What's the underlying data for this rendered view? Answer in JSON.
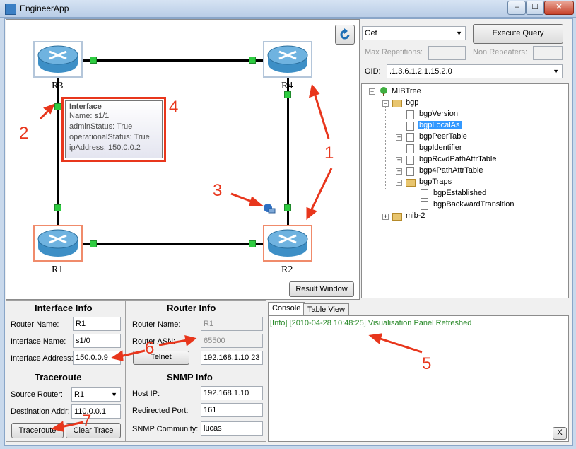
{
  "window": {
    "title": "EngineerApp",
    "minimize": "–",
    "maximize": "☐",
    "close": "✕"
  },
  "canvas": {
    "refresh_icon": "refresh-icon",
    "routers": [
      {
        "label": "R3"
      },
      {
        "label": "R4"
      },
      {
        "label": "R1"
      },
      {
        "label": "R2"
      }
    ],
    "tooltip": {
      "title": "Interface",
      "lines": [
        "Name: s1/1",
        "adminStatus: True",
        "operationalStatus: True",
        "ipAddress: 150.0.0.2"
      ]
    },
    "annotations": [
      "1",
      "2",
      "3",
      "4",
      "5",
      "6",
      "7"
    ],
    "result_window_button": "Result Window"
  },
  "query": {
    "operation": "Get",
    "execute_button": "Execute Query",
    "max_repetitions_label": "Max Repetitions:",
    "non_repeaters_label": "Non Repeaters:",
    "oid_label": "OID:",
    "oid_value": ".1.3.6.1.2.1.15.2.0"
  },
  "tree": {
    "root": "MIBTree",
    "bgp": "bgp",
    "items": [
      "bgpVersion",
      "bgpLocalAs",
      "bgpPeerTable",
      "bgpIdentifier",
      "bgpRcvdPathAttrTable",
      "bgp4PathAttrTable"
    ],
    "traps": "bgpTraps",
    "trap_items": [
      "bgpEstablished",
      "bgpBackwardTransition"
    ],
    "mib2": "mib-2"
  },
  "interface_info": {
    "title": "Interface Info",
    "router_name_label": "Router Name:",
    "router_name": "R1",
    "interface_name_label": "Interface Name:",
    "interface_name": "s1/0",
    "interface_address_label": "Interface Address:",
    "interface_address": "150.0.0.9"
  },
  "router_info": {
    "title": "Router Info",
    "router_name_label": "Router Name:",
    "router_name": "R1",
    "router_asn_label": "Router ASN:",
    "router_asn": "65500",
    "telnet_button": "Telnet",
    "telnet_address": "192.168.1.10 23"
  },
  "traceroute": {
    "title": "Traceroute",
    "source_label": "Source Router:",
    "source": "R1",
    "destination_label": "Destination Addr:",
    "destination": "110.0.0.1",
    "traceroute_button": "Traceroute",
    "clear_button": "Clear Trace"
  },
  "snmp_info": {
    "title": "SNMP Info",
    "host_ip_label": "Host IP:",
    "host_ip": "192.168.1.10",
    "redirected_port_label": "Redirected Port:",
    "redirected_port": "161",
    "community_label": "SNMP Community:",
    "community": "lucas"
  },
  "console": {
    "tabs": [
      "Console",
      "Table View"
    ],
    "message": "[Info] [2010-04-28 10:48:25] Visualisation Panel Refreshed",
    "close_button": "X"
  },
  "colors": {
    "accent_red": "#e8361c",
    "link_green": "#2ecc40",
    "console_text": "#2a8a2a"
  }
}
